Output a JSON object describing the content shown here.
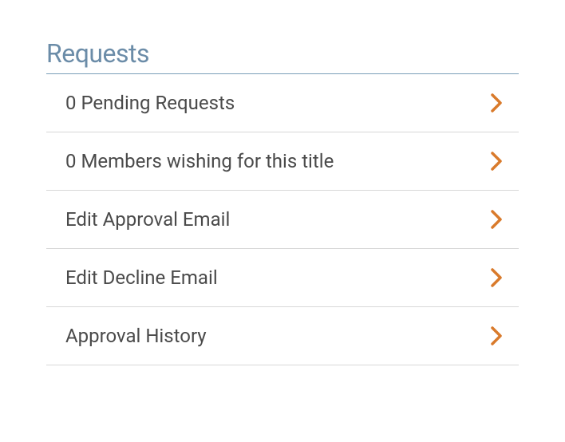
{
  "section_title": "Requests",
  "items": [
    {
      "label": "0 Pending Requests"
    },
    {
      "label": "0 Members wishing for this title"
    },
    {
      "label": "Edit Approval Email"
    },
    {
      "label": "Edit Decline Email"
    },
    {
      "label": "Approval History"
    }
  ],
  "colors": {
    "chevron": "#d97a2b"
  }
}
